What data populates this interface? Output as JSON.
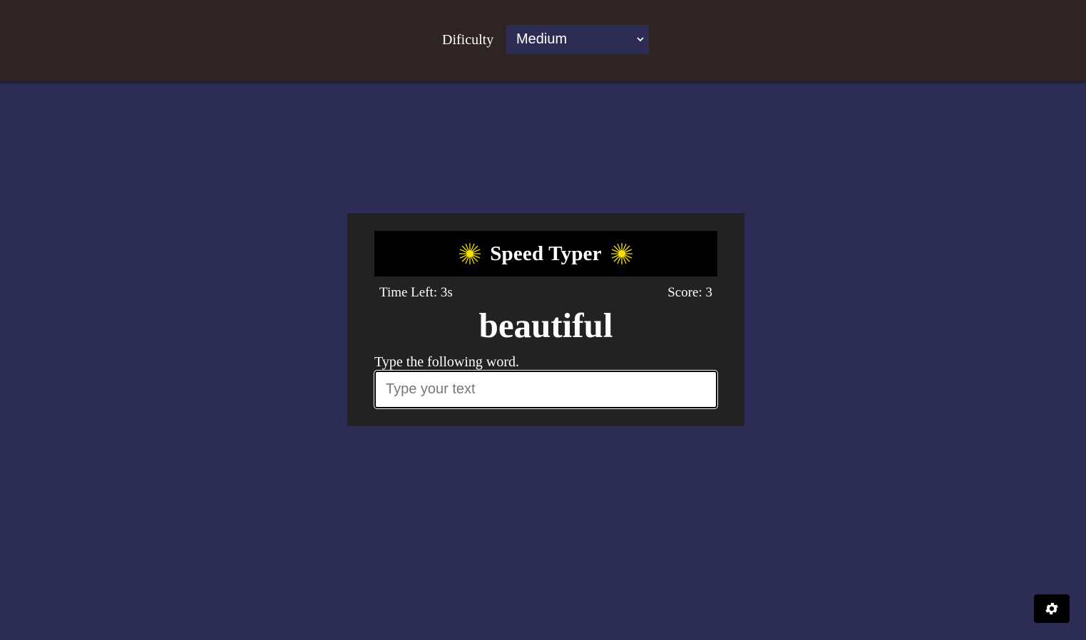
{
  "header": {
    "difficulty_label": "Dificulty",
    "difficulty_selected": "Medium"
  },
  "game": {
    "title": "Speed Typer",
    "time_left": "Time Left: 3s",
    "score": "Score: 3",
    "word": "beautiful",
    "instruction": "Type the following word.",
    "input_placeholder": "Type your text",
    "input_value": ""
  },
  "icons": {
    "title_left": "sparkle-icon",
    "title_right": "sparkle-icon",
    "select_arrow": "chevron-down-icon",
    "settings": "gear-icon"
  },
  "colors": {
    "header_bg": "#2f2424",
    "page_bg": "#2c2c54",
    "card_bg": "#222222",
    "title_bar_bg": "#000000",
    "sparkle": "#f5e000"
  }
}
